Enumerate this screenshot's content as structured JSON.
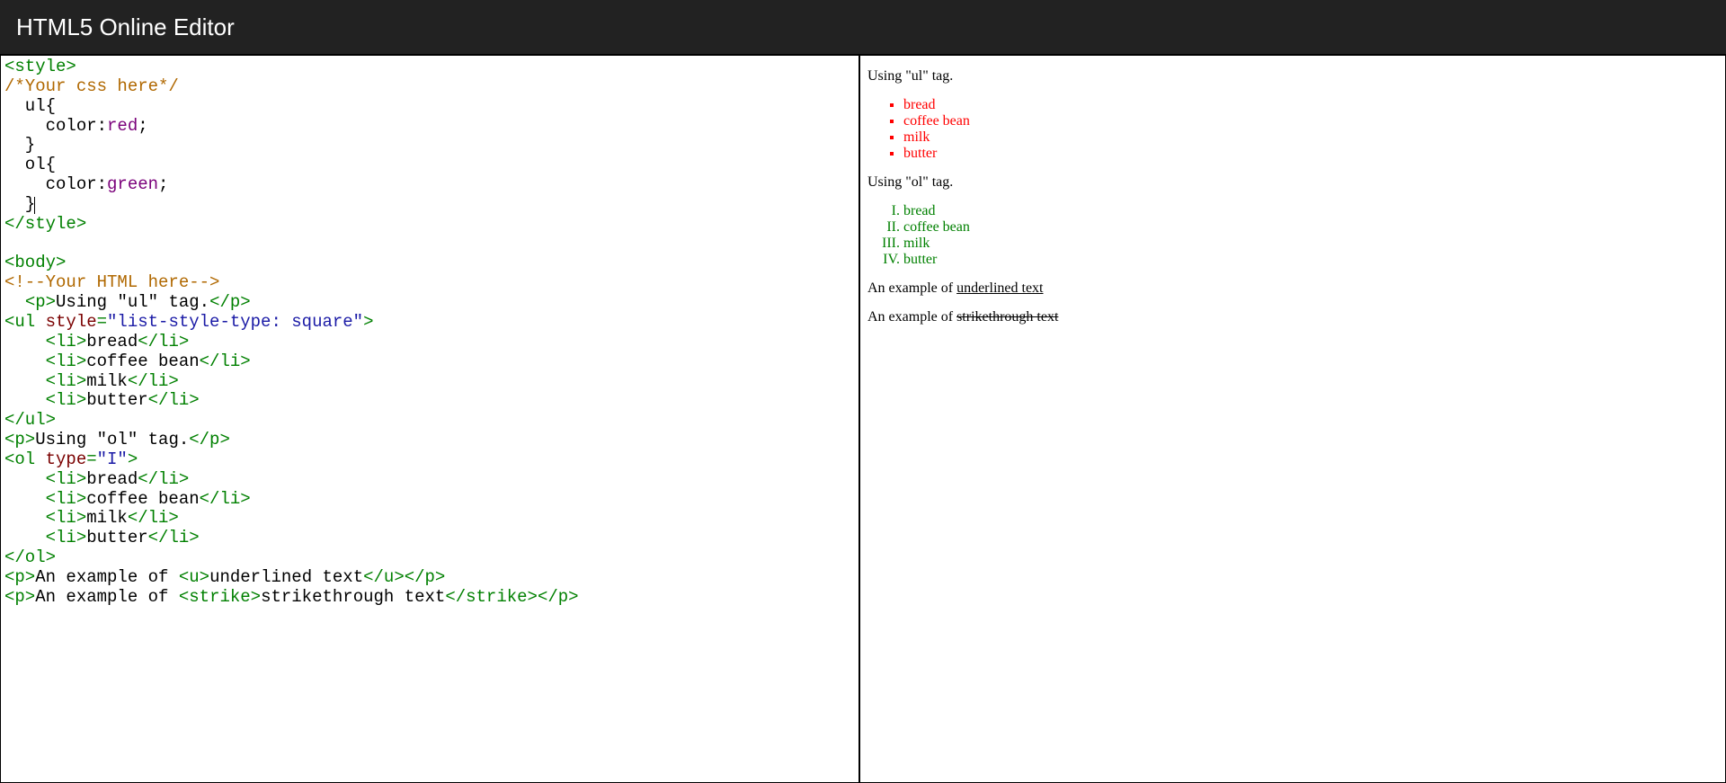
{
  "header": {
    "title": "HTML5 Online Editor"
  },
  "code": {
    "lines": [
      [
        {
          "t": "tag",
          "v": "<style>"
        }
      ],
      [
        {
          "t": "comment",
          "v": "/*Your css here*/"
        }
      ],
      [
        {
          "t": "plain",
          "v": "  ul{"
        }
      ],
      [
        {
          "t": "plain",
          "v": "    color:"
        },
        {
          "t": "cssval",
          "v": "red"
        },
        {
          "t": "plain",
          "v": ";"
        }
      ],
      [
        {
          "t": "plain",
          "v": "  }"
        }
      ],
      [
        {
          "t": "plain",
          "v": "  ol{"
        }
      ],
      [
        {
          "t": "plain",
          "v": "    color:"
        },
        {
          "t": "cssval",
          "v": "green"
        },
        {
          "t": "plain",
          "v": ";"
        }
      ],
      [
        {
          "t": "plain",
          "v": "  }"
        },
        {
          "t": "caret",
          "v": ""
        }
      ],
      [
        {
          "t": "tag",
          "v": "</style>"
        }
      ],
      [],
      [
        {
          "t": "tag",
          "v": "<body>"
        }
      ],
      [
        {
          "t": "comment",
          "v": "<!--Your HTML here-->"
        }
      ],
      [
        {
          "t": "plain",
          "v": "  "
        },
        {
          "t": "tag",
          "v": "<p>"
        },
        {
          "t": "plain",
          "v": "Using \"ul\" tag."
        },
        {
          "t": "tag",
          "v": "</p>"
        }
      ],
      [
        {
          "t": "tag",
          "v": "<ul "
        },
        {
          "t": "attr",
          "v": "style"
        },
        {
          "t": "tag",
          "v": "="
        },
        {
          "t": "str",
          "v": "\"list-style-type: square\""
        },
        {
          "t": "tag",
          "v": ">"
        }
      ],
      [
        {
          "t": "plain",
          "v": "    "
        },
        {
          "t": "tag",
          "v": "<li>"
        },
        {
          "t": "plain",
          "v": "bread"
        },
        {
          "t": "tag",
          "v": "</li>"
        }
      ],
      [
        {
          "t": "plain",
          "v": "    "
        },
        {
          "t": "tag",
          "v": "<li>"
        },
        {
          "t": "plain",
          "v": "coffee bean"
        },
        {
          "t": "tag",
          "v": "</li>"
        }
      ],
      [
        {
          "t": "plain",
          "v": "    "
        },
        {
          "t": "tag",
          "v": "<li>"
        },
        {
          "t": "plain",
          "v": "milk"
        },
        {
          "t": "tag",
          "v": "</li>"
        }
      ],
      [
        {
          "t": "plain",
          "v": "    "
        },
        {
          "t": "tag",
          "v": "<li>"
        },
        {
          "t": "plain",
          "v": "butter"
        },
        {
          "t": "tag",
          "v": "</li>"
        }
      ],
      [
        {
          "t": "tag",
          "v": "</ul>"
        }
      ],
      [
        {
          "t": "tag",
          "v": "<p>"
        },
        {
          "t": "plain",
          "v": "Using \"ol\" tag."
        },
        {
          "t": "tag",
          "v": "</p>"
        }
      ],
      [
        {
          "t": "tag",
          "v": "<ol "
        },
        {
          "t": "attr",
          "v": "type"
        },
        {
          "t": "tag",
          "v": "="
        },
        {
          "t": "str",
          "v": "\"I\""
        },
        {
          "t": "tag",
          "v": ">"
        }
      ],
      [
        {
          "t": "plain",
          "v": "    "
        },
        {
          "t": "tag",
          "v": "<li>"
        },
        {
          "t": "plain",
          "v": "bread"
        },
        {
          "t": "tag",
          "v": "</li>"
        }
      ],
      [
        {
          "t": "plain",
          "v": "    "
        },
        {
          "t": "tag",
          "v": "<li>"
        },
        {
          "t": "plain",
          "v": "coffee bean"
        },
        {
          "t": "tag",
          "v": "</li>"
        }
      ],
      [
        {
          "t": "plain",
          "v": "    "
        },
        {
          "t": "tag",
          "v": "<li>"
        },
        {
          "t": "plain",
          "v": "milk"
        },
        {
          "t": "tag",
          "v": "</li>"
        }
      ],
      [
        {
          "t": "plain",
          "v": "    "
        },
        {
          "t": "tag",
          "v": "<li>"
        },
        {
          "t": "plain",
          "v": "butter"
        },
        {
          "t": "tag",
          "v": "</li>"
        }
      ],
      [
        {
          "t": "tag",
          "v": "</ol>"
        }
      ],
      [
        {
          "t": "tag",
          "v": "<p>"
        },
        {
          "t": "plain",
          "v": "An example of "
        },
        {
          "t": "tag",
          "v": "<u>"
        },
        {
          "t": "plain",
          "v": "underlined text"
        },
        {
          "t": "tag",
          "v": "</u>"
        },
        {
          "t": "tag",
          "v": "</p>"
        }
      ],
      [
        {
          "t": "tag",
          "v": "<p>"
        },
        {
          "t": "plain",
          "v": "An example of "
        },
        {
          "t": "tag",
          "v": "<strike>"
        },
        {
          "t": "plain",
          "v": "strikethrough text"
        },
        {
          "t": "tag",
          "v": "</strike>"
        },
        {
          "t": "tag",
          "v": "</p>"
        }
      ]
    ]
  },
  "preview": {
    "p_ul_intro": "Using \"ul\" tag.",
    "ul_items": [
      "bread",
      "coffee bean",
      "milk",
      "butter"
    ],
    "p_ol_intro": "Using \"ol\" tag.",
    "ol_items": [
      "bread",
      "coffee bean",
      "milk",
      "butter"
    ],
    "underline_pre": "An example of ",
    "underline_text": "underlined text",
    "strike_pre": "An example of ",
    "strike_text": "strikethrough text"
  }
}
